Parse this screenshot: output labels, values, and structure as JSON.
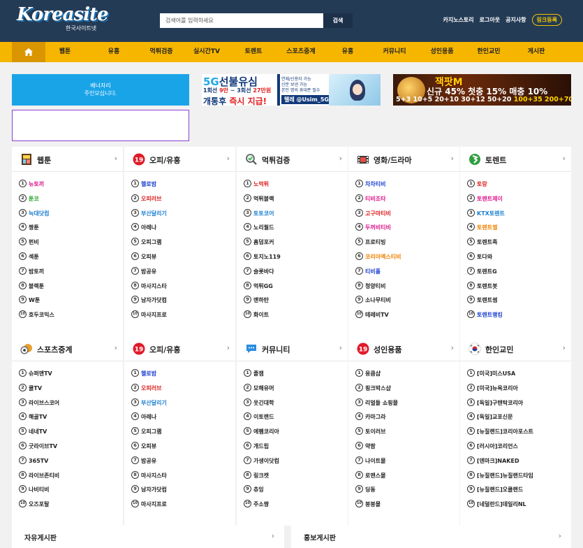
{
  "header": {
    "logo_text": "Koreasite",
    "logo_sub": "한국사이트넷",
    "search_placeholder": "검색어를 입력하세요",
    "search_button": "검색",
    "links": [
      "카지노스토리",
      "로그아웃",
      "공지사항"
    ],
    "register_button": "링크등록"
  },
  "nav": {
    "items": [
      "웹툰",
      "유흥",
      "먹튀검증",
      "실시간TV",
      "토렌트",
      "스포츠중계",
      "유흥",
      "커뮤니티",
      "성인용품",
      "한인교민",
      "게시판"
    ]
  },
  "banners": {
    "blue_line1": "배너자리",
    "blue_line2": "주인모십니다.",
    "fiveg": {
      "line1_a": "5G",
      "line1_b": "선불유심",
      "line2_a": "1회선 ",
      "line2_b": "9만",
      "line2_c": " ~ 3회선 ",
      "line2_d": "27만원",
      "line3_a": "개통후 ",
      "line3_b": "즉시 지급!",
      "points": [
        "연체/신용자 가능",
        "신분 보낸 가능",
        "본인 명의 휴대폰 필수"
      ],
      "telegram": "텔레 @Usim_5G"
    },
    "jackpot": {
      "title": "잭팟M",
      "line2": "신규 45% 첫충 15% 매충 10%",
      "line3_a": "5+3 10+5 20+10 30+12 50+20 ",
      "line3_b": "100+35 200+70"
    }
  },
  "categories": [
    {
      "title": "웹툰",
      "icon": "webtoon-icon",
      "items": [
        {
          "t": "뉴토끼",
          "c": "#e0168c"
        },
        {
          "t": "툰코",
          "c": "#2fa82f"
        },
        {
          "t": "늑대닷컴",
          "c": "#1b7fd0"
        },
        {
          "t": "짱툰",
          "c": "#222222"
        },
        {
          "t": "펀비",
          "c": "#222222"
        },
        {
          "t": "섹툰",
          "c": "#222222"
        },
        {
          "t": "밤토끼",
          "c": "#222222"
        },
        {
          "t": "블랙툰",
          "c": "#222222"
        },
        {
          "t": "W툰",
          "c": "#222222"
        },
        {
          "t": "호두코믹스",
          "c": "#222222"
        }
      ]
    },
    {
      "title": "오피/유흥",
      "icon": "adult-19-icon",
      "items": [
        {
          "t": "헬로밤",
          "c": "#1b3fd0"
        },
        {
          "t": "오피러브",
          "c": "#e02020"
        },
        {
          "t": "부산달리기",
          "c": "#1b7fd0"
        },
        {
          "t": "아레나",
          "c": "#222222"
        },
        {
          "t": "오피그램",
          "c": "#222222"
        },
        {
          "t": "오피뷰",
          "c": "#222222"
        },
        {
          "t": "밤공유",
          "c": "#222222"
        },
        {
          "t": "마사지스타",
          "c": "#222222"
        },
        {
          "t": "남자가닷컴",
          "c": "#222222"
        },
        {
          "t": "마사지프로",
          "c": "#222222"
        }
      ]
    },
    {
      "title": "먹튀검증",
      "icon": "magnifier-icon",
      "items": [
        {
          "t": "노먹튀",
          "c": "#e02020"
        },
        {
          "t": "먹튀블랙",
          "c": "#222222"
        },
        {
          "t": "토토코어",
          "c": "#1b7fd0"
        },
        {
          "t": "노리월드",
          "c": "#222222"
        },
        {
          "t": "홈덤포커",
          "c": "#222222"
        },
        {
          "t": "토지노119",
          "c": "#222222"
        },
        {
          "t": "슬롯바다",
          "c": "#222222"
        },
        {
          "t": "먹튀GG",
          "c": "#222222"
        },
        {
          "t": "맨하탄",
          "c": "#222222"
        },
        {
          "t": "화이트",
          "c": "#222222"
        }
      ]
    },
    {
      "title": "영화/드라마",
      "icon": "film-icon",
      "items": [
        {
          "t": "차차티비",
          "c": "#1b3fd0"
        },
        {
          "t": "티비조타",
          "c": "#e0168c"
        },
        {
          "t": "고구마티비",
          "c": "#e02020"
        },
        {
          "t": "두꺼비티비",
          "c": "#e0168c"
        },
        {
          "t": "프로티빙",
          "c": "#222222"
        },
        {
          "t": "코리아엑스티비",
          "c": "#f08000"
        },
        {
          "t": "티비홀",
          "c": "#1b3fd0"
        },
        {
          "t": "청양티비",
          "c": "#222222"
        },
        {
          "t": "소나무티비",
          "c": "#222222"
        },
        {
          "t": "테레비TV",
          "c": "#222222"
        }
      ]
    },
    {
      "title": "토렌트",
      "icon": "torrent-icon",
      "items": [
        {
          "t": "토랑",
          "c": "#e02020"
        },
        {
          "t": "토렌트제이",
          "c": "#e0168c"
        },
        {
          "t": "KTX토렌트",
          "c": "#1b7fd0"
        },
        {
          "t": "토렌트썰",
          "c": "#f08000"
        },
        {
          "t": "토렌트족",
          "c": "#222222"
        },
        {
          "t": "토다와",
          "c": "#222222"
        },
        {
          "t": "토렌트G",
          "c": "#222222"
        },
        {
          "t": "토렌트봇",
          "c": "#222222"
        },
        {
          "t": "토렌트썸",
          "c": "#222222"
        },
        {
          "t": "토렌트랭킹",
          "c": "#1b3fd0"
        }
      ]
    },
    {
      "title": "스포츠중계",
      "icon": "sports-ball-icon",
      "items": [
        {
          "t": "슈퍼맨TV",
          "c": "#222222"
        },
        {
          "t": "쿨TV",
          "c": "#222222"
        },
        {
          "t": "라이브스코어",
          "c": "#222222"
        },
        {
          "t": "해골TV",
          "c": "#222222"
        },
        {
          "t": "네네TV",
          "c": "#222222"
        },
        {
          "t": "굿라이브TV",
          "c": "#222222"
        },
        {
          "t": "365TV",
          "c": "#222222"
        },
        {
          "t": "라이브존티비",
          "c": "#222222"
        },
        {
          "t": "나비티비",
          "c": "#222222"
        },
        {
          "t": "오즈포탈",
          "c": "#222222"
        }
      ]
    },
    {
      "title": "오피/유흥",
      "icon": "adult-19-icon",
      "items": [
        {
          "t": "헬로밤",
          "c": "#1b3fd0"
        },
        {
          "t": "오피러브",
          "c": "#e02020"
        },
        {
          "t": "부산달리기",
          "c": "#1b7fd0"
        },
        {
          "t": "아레나",
          "c": "#222222"
        },
        {
          "t": "오피그램",
          "c": "#222222"
        },
        {
          "t": "오피뷰",
          "c": "#222222"
        },
        {
          "t": "밤공유",
          "c": "#222222"
        },
        {
          "t": "마사지스타",
          "c": "#222222"
        },
        {
          "t": "남자가닷컴",
          "c": "#222222"
        },
        {
          "t": "마사지프로",
          "c": "#222222"
        }
      ]
    },
    {
      "title": "커뮤니티",
      "icon": "chat-bubble-icon",
      "items": [
        {
          "t": "졸잼",
          "c": "#222222"
        },
        {
          "t": "모해유머",
          "c": "#222222"
        },
        {
          "t": "웃긴대학",
          "c": "#222222"
        },
        {
          "t": "이토랜드",
          "c": "#222222"
        },
        {
          "t": "에펨코리아",
          "c": "#222222"
        },
        {
          "t": "개드립",
          "c": "#222222"
        },
        {
          "t": "가생이닷컴",
          "c": "#222222"
        },
        {
          "t": "링크캣",
          "c": "#222222"
        },
        {
          "t": "츄잉",
          "c": "#222222"
        },
        {
          "t": "주소짱",
          "c": "#222222"
        }
      ]
    },
    {
      "title": "성인용품",
      "icon": "adult-19-icon",
      "items": [
        {
          "t": "응큼샵",
          "c": "#222222"
        },
        {
          "t": "핑크박스샵",
          "c": "#222222"
        },
        {
          "t": "리얼돌 쇼핑몰",
          "c": "#222222"
        },
        {
          "t": "카마그라",
          "c": "#222222"
        },
        {
          "t": "토이러브",
          "c": "#222222"
        },
        {
          "t": "약팜",
          "c": "#222222"
        },
        {
          "t": "나이트몰",
          "c": "#222222"
        },
        {
          "t": "로맨스몰",
          "c": "#222222"
        },
        {
          "t": "딩동",
          "c": "#222222"
        },
        {
          "t": "붕붕몰",
          "c": "#222222"
        }
      ]
    },
    {
      "title": "한인교민",
      "icon": "korea-flag-icon",
      "items": [
        {
          "t": "[미국]미스USA",
          "c": "#222222"
        },
        {
          "t": "[미국]뉴욕코리아",
          "c": "#222222"
        },
        {
          "t": "[독일]구텐탁코리아",
          "c": "#222222"
        },
        {
          "t": "[독일]교포신문",
          "c": "#222222"
        },
        {
          "t": "[뉴질랜드]코리아포스트",
          "c": "#222222"
        },
        {
          "t": "[러시아]코리언스",
          "c": "#222222"
        },
        {
          "t": "[덴마크]NAKED",
          "c": "#222222"
        },
        {
          "t": "[뉴질랜드]뉴질랜드타임",
          "c": "#222222"
        },
        {
          "t": "[뉴질랜드]오클랜드",
          "c": "#222222"
        },
        {
          "t": "[네덜란드]데일리NL",
          "c": "#222222"
        }
      ]
    }
  ],
  "boards": [
    "자유게시판",
    "홍보게시판"
  ],
  "colors": {
    "header_bg": "#243b55",
    "nav_bg": "#f6b600",
    "accent_yellow": "#f2c200"
  }
}
